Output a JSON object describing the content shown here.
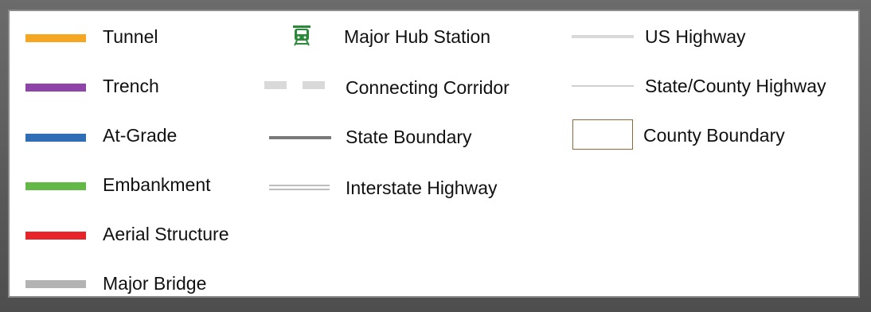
{
  "legend": {
    "column1": [
      {
        "label": "Tunnel",
        "color": "#f5a623"
      },
      {
        "label": "Trench",
        "color": "#8e44a8"
      },
      {
        "label": "At-Grade",
        "color": "#2f6db5"
      },
      {
        "label": "Embankment",
        "color": "#63b946"
      },
      {
        "label": "Aerial Structure",
        "color": "#e8242b"
      },
      {
        "label": "Major Bridge",
        "color": "#b3b3b3"
      }
    ],
    "column2": [
      {
        "label": "Major Hub Station",
        "icon": "train-station-icon",
        "color": "#2a8a3a"
      },
      {
        "label": "Connecting Corridor",
        "style": "dashed-line",
        "color": "#d9d9d9"
      },
      {
        "label": "State Boundary",
        "style": "thick-line",
        "color": "#7a7a7a"
      },
      {
        "label": "Interstate Highway",
        "style": "double-line",
        "color": "#bdbdbd"
      }
    ],
    "column3": [
      {
        "label": "US Highway",
        "style": "medium-line",
        "color": "#d9d9d9"
      },
      {
        "label": "State/County Highway",
        "style": "thin-line",
        "color": "#cfcfcf"
      },
      {
        "label": "County Boundary",
        "style": "outlined-box",
        "color": "#8a6a3a"
      }
    ]
  }
}
